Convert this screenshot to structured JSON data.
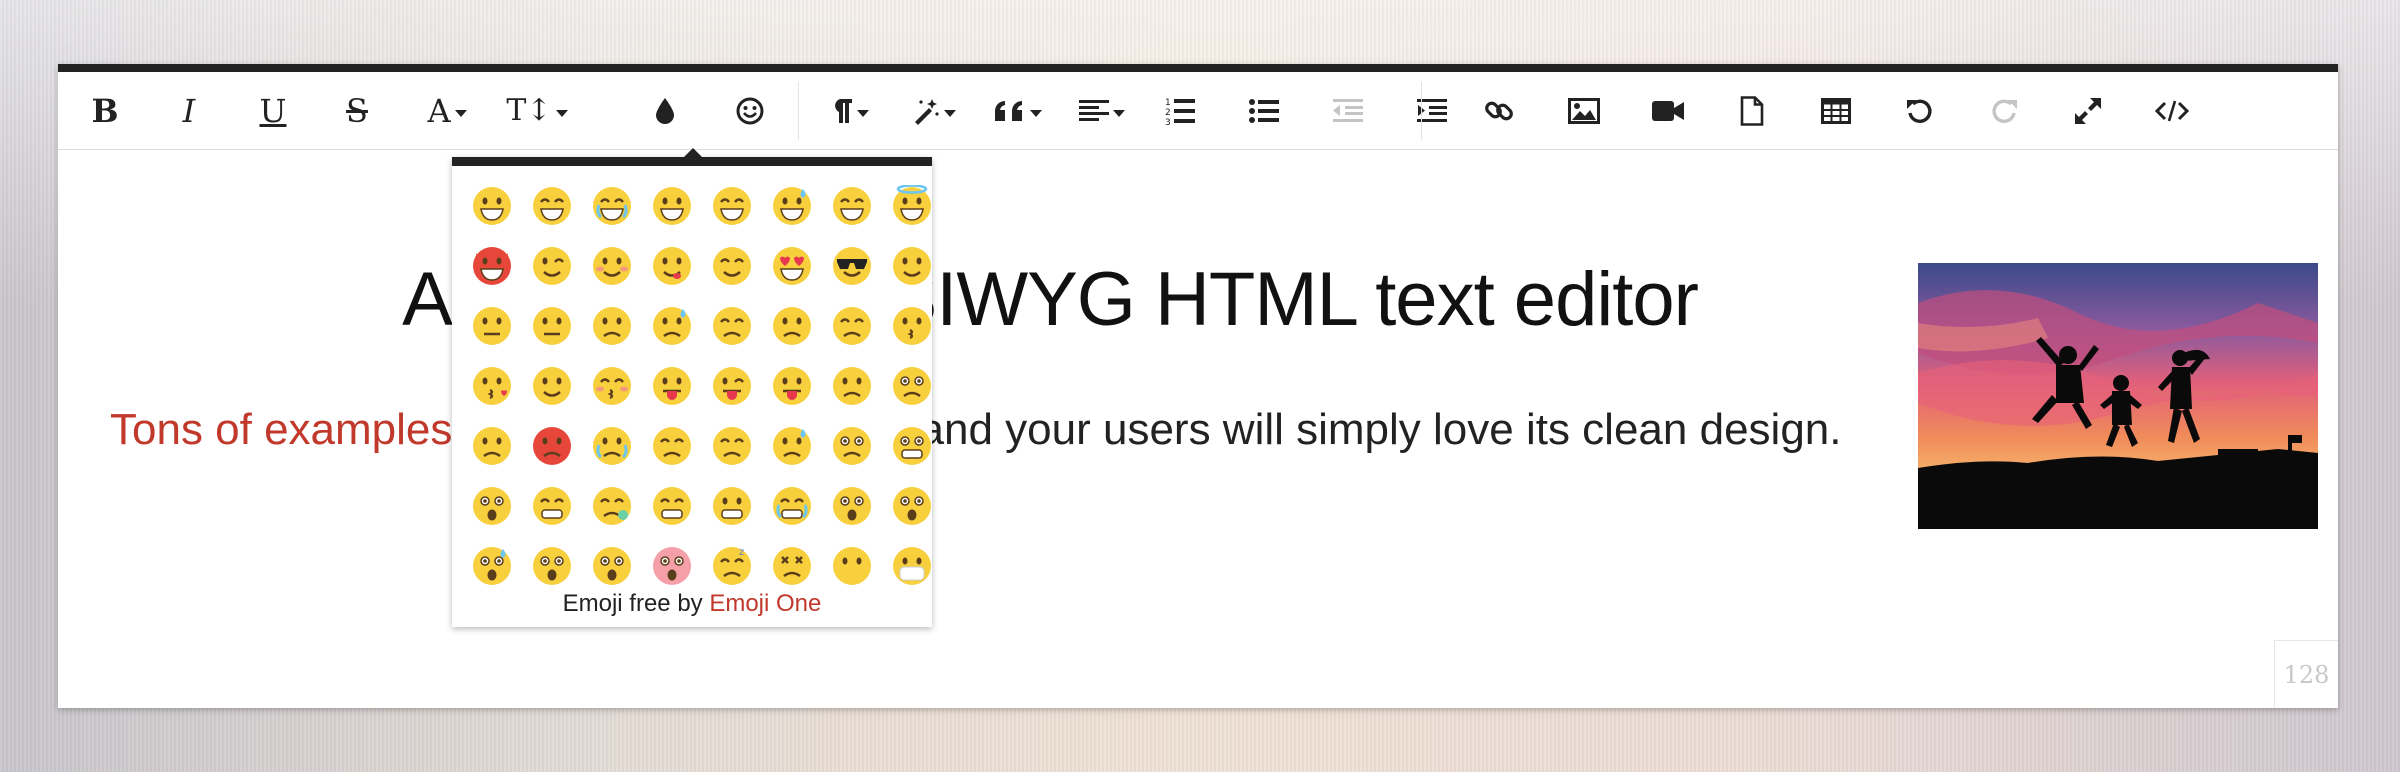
{
  "editor": {
    "heading": "A beautiful WYSIWYG HTML text editor",
    "subline_link": "Tons of examples",
    "subline_text": " to customize the editor and your users will simply love its clean design.",
    "char_counter": "128",
    "image_name": "sunset-jumping-people"
  },
  "toolbar": {
    "buttons": [
      {
        "name": "bold",
        "label": "B",
        "icon": "bold-icon"
      },
      {
        "name": "italic",
        "label": "I",
        "icon": "italic-icon"
      },
      {
        "name": "underline",
        "label": "U",
        "icon": "underline-icon"
      },
      {
        "name": "strikethrough",
        "label": "S",
        "icon": "strikethrough-icon"
      },
      {
        "name": "font-family",
        "label": "A",
        "icon": "font-family-icon"
      },
      {
        "name": "font-size",
        "label": "T↕",
        "icon": "font-size-icon"
      },
      {
        "name": "color",
        "icon": "color-drop-icon"
      },
      {
        "name": "emoticons",
        "icon": "smiley-icon"
      },
      {
        "name": "paragraph-format",
        "icon": "pilcrow-icon"
      },
      {
        "name": "paragraph-style",
        "icon": "magic-wand-icon"
      },
      {
        "name": "quote",
        "icon": "quote-icon"
      },
      {
        "name": "align",
        "icon": "align-left-icon"
      },
      {
        "name": "ordered-list",
        "icon": "ordered-list-icon"
      },
      {
        "name": "unordered-list",
        "icon": "bullet-list-icon"
      },
      {
        "name": "outdent",
        "icon": "outdent-icon"
      },
      {
        "name": "indent",
        "icon": "indent-icon"
      },
      {
        "name": "insert-link",
        "icon": "link-icon"
      },
      {
        "name": "insert-image",
        "icon": "image-icon"
      },
      {
        "name": "insert-video",
        "icon": "video-icon"
      },
      {
        "name": "insert-file",
        "icon": "file-icon"
      },
      {
        "name": "insert-table",
        "icon": "table-icon"
      },
      {
        "name": "undo",
        "icon": "undo-icon"
      },
      {
        "name": "redo",
        "icon": "redo-icon"
      },
      {
        "name": "fullscreen",
        "icon": "expand-icon"
      },
      {
        "name": "html",
        "icon": "code-icon"
      }
    ]
  },
  "emoji_popup": {
    "footer_text": "Emoji free by ",
    "footer_link": "Emoji One",
    "emojis": [
      "grinning",
      "grin",
      "joy",
      "smiley",
      "smile",
      "sweat-smile",
      "laughing",
      "innocent",
      "smiling-imp",
      "wink",
      "blush",
      "yum",
      "relieved",
      "heart-eyes",
      "sunglasses",
      "smirk",
      "neutral-face",
      "expressionless",
      "unamused",
      "sweat",
      "pensive",
      "confused",
      "confounded",
      "kissing",
      "kissing-heart",
      "kissing-smiling-eyes",
      "kissing-closed-eyes",
      "stuck-out-tongue",
      "stuck-out-tongue-winking-eye",
      "stuck-out-tongue-closed-eyes",
      "disappointed",
      "worried",
      "angry",
      "rage",
      "cry",
      "persevere",
      "triumph",
      "disappointed-relieved",
      "frowning",
      "anguished",
      "fearful",
      "weary",
      "sleepy",
      "tired-face",
      "grimacing",
      "sob",
      "open-mouth",
      "hushed",
      "cold-sweat",
      "scream",
      "astonished",
      "flushed",
      "sleeping",
      "dizzy-face",
      "no-mouth",
      "mask"
    ]
  },
  "colors": {
    "accent_red": "#c0392b",
    "toolbar_dark": "#222222",
    "emoji_yellow": "#f8cf3d",
    "emoji_red": "#e7473b"
  }
}
